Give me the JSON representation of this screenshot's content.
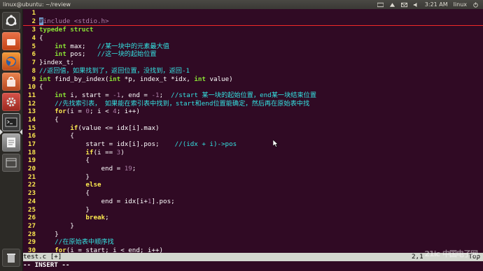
{
  "window": {
    "title": "linux@ubuntu: ~/review"
  },
  "tray": {
    "time": "3:21 AM",
    "user": "linux"
  },
  "launcher": {
    "items": [
      {
        "name": "dash-home",
        "icon": "ubuntu-logo-icon",
        "color": "#a0a0a0"
      },
      {
        "name": "ubuntu-one",
        "icon": "ubuntu-one-icon",
        "color": "#e05a2d"
      },
      {
        "name": "firefox",
        "icon": "firefox-icon",
        "color": "#e86a1d"
      },
      {
        "name": "software-center",
        "icon": "shopping-bag-icon",
        "color": "#dc6b3c"
      },
      {
        "name": "system-settings",
        "icon": "settings-icon",
        "color": "#c0392b"
      },
      {
        "name": "terminal",
        "icon": "terminal-icon",
        "color": "#3b3b3b"
      },
      {
        "name": "text-editor",
        "icon": "text-editor-icon",
        "color": "#8a8a8a"
      },
      {
        "name": "workspace-switcher",
        "icon": "workspace-icon",
        "color": "#555555"
      },
      {
        "name": "trash",
        "icon": "trash-icon",
        "color": "#666666"
      }
    ]
  },
  "editor": {
    "lines": [
      {
        "n": "1",
        "t": []
      },
      {
        "n": "2",
        "t": [
          [
            "cursor",
            "#"
          ],
          [
            "pre",
            "include <stdio.h>"
          ]
        ],
        "cursorline": true
      },
      {
        "n": "3",
        "t": [
          [
            "type",
            "typedef struct"
          ]
        ]
      },
      {
        "n": "4",
        "t": [
          [
            "txt",
            "{"
          ]
        ]
      },
      {
        "n": "5",
        "t": [
          [
            "txt",
            "    "
          ],
          [
            "type",
            "int"
          ],
          [
            "txt",
            " max;   "
          ],
          [
            "cm",
            "//某一块中的元素最大值"
          ]
        ]
      },
      {
        "n": "6",
        "t": [
          [
            "txt",
            "    "
          ],
          [
            "type",
            "int"
          ],
          [
            "txt",
            " pos;   "
          ],
          [
            "cm",
            "//这一块的起始位置"
          ]
        ]
      },
      {
        "n": "7",
        "t": [
          [
            "txt",
            "}index_t;"
          ]
        ]
      },
      {
        "n": "8",
        "t": [
          [
            "cm",
            "//返回值，如果找到了，返回位置，没找到，返回-1"
          ]
        ]
      },
      {
        "n": "9",
        "t": [
          [
            "type",
            "int"
          ],
          [
            "txt",
            " find_by_index("
          ],
          [
            "type",
            "int"
          ],
          [
            "txt",
            " *p, index_t *idx, "
          ],
          [
            "type",
            "int"
          ],
          [
            "txt",
            " value)"
          ]
        ]
      },
      {
        "n": "10",
        "t": [
          [
            "txt",
            "{"
          ]
        ]
      },
      {
        "n": "11",
        "t": [
          [
            "txt",
            "    "
          ],
          [
            "type",
            "int"
          ],
          [
            "txt",
            " i, start = "
          ],
          [
            "num",
            "-1"
          ],
          [
            "txt",
            ", end = "
          ],
          [
            "num",
            "-1"
          ],
          [
            "txt",
            ";  "
          ],
          [
            "cm",
            "//start 某一块的起始位置，end某一块结束位置"
          ]
        ]
      },
      {
        "n": "12",
        "t": [
          [
            "txt",
            "    "
          ],
          [
            "cm",
            "//先找索引表， 如果能在索引表中找到，start和end位置能确定，然后再在原始表中找"
          ]
        ]
      },
      {
        "n": "13",
        "t": [
          [
            "txt",
            "    "
          ],
          [
            "kw",
            "for"
          ],
          [
            "txt",
            "(i = "
          ],
          [
            "num",
            "0"
          ],
          [
            "txt",
            "; i < "
          ],
          [
            "num",
            "4"
          ],
          [
            "txt",
            "; i++)"
          ]
        ]
      },
      {
        "n": "14",
        "t": [
          [
            "txt",
            "    {"
          ]
        ]
      },
      {
        "n": "15",
        "t": [
          [
            "txt",
            "        "
          ],
          [
            "kw",
            "if"
          ],
          [
            "txt",
            "(value <= idx["
          ],
          [
            "txt",
            "i"
          ],
          [
            "txt",
            "].max)"
          ]
        ]
      },
      {
        "n": "16",
        "t": [
          [
            "txt",
            "        {"
          ]
        ]
      },
      {
        "n": "17",
        "t": [
          [
            "txt",
            "            start = idx["
          ],
          [
            "txt",
            "i"
          ],
          [
            "txt",
            "].pos;    "
          ],
          [
            "cm",
            "//(idx + i)->pos"
          ]
        ]
      },
      {
        "n": "18",
        "t": [
          [
            "txt",
            "            "
          ],
          [
            "kw",
            "if"
          ],
          [
            "txt",
            "(i == "
          ],
          [
            "num",
            "3"
          ],
          [
            "txt",
            ")"
          ]
        ]
      },
      {
        "n": "19",
        "t": [
          [
            "txt",
            "            {"
          ]
        ]
      },
      {
        "n": "20",
        "t": [
          [
            "txt",
            "                end = "
          ],
          [
            "num",
            "19"
          ],
          [
            "txt",
            ";"
          ]
        ]
      },
      {
        "n": "21",
        "t": [
          [
            "txt",
            "            }"
          ]
        ]
      },
      {
        "n": "22",
        "t": [
          [
            "txt",
            "            "
          ],
          [
            "kw",
            "else"
          ]
        ]
      },
      {
        "n": "23",
        "t": [
          [
            "txt",
            "            {"
          ]
        ]
      },
      {
        "n": "24",
        "t": [
          [
            "txt",
            "                end = idx["
          ],
          [
            "txt",
            "i+"
          ],
          [
            "num",
            "1"
          ],
          [
            "txt",
            "].pos;"
          ]
        ]
      },
      {
        "n": "25",
        "t": [
          [
            "txt",
            "            }"
          ]
        ]
      },
      {
        "n": "26",
        "t": [
          [
            "txt",
            "            "
          ],
          [
            "kw",
            "break"
          ],
          [
            "txt",
            ";"
          ]
        ]
      },
      {
        "n": "27",
        "t": [
          [
            "txt",
            "        }"
          ]
        ]
      },
      {
        "n": "28",
        "t": [
          [
            "txt",
            "    }"
          ]
        ]
      },
      {
        "n": "29",
        "t": [
          [
            "txt",
            "    "
          ],
          [
            "cm",
            "//在原始表中顺序找"
          ]
        ]
      },
      {
        "n": "30",
        "t": [
          [
            "txt",
            "    "
          ],
          [
            "kw",
            "for"
          ],
          [
            "txt",
            "(i = start; i < end; i++)"
          ]
        ]
      }
    ]
  },
  "status": {
    "file": "test.c [+]",
    "pos": "2,1",
    "scroll": "Top"
  },
  "mode": "-- INSERT --",
  "watermark": {
    "text": "21ic",
    "sub": "中国电子网"
  }
}
